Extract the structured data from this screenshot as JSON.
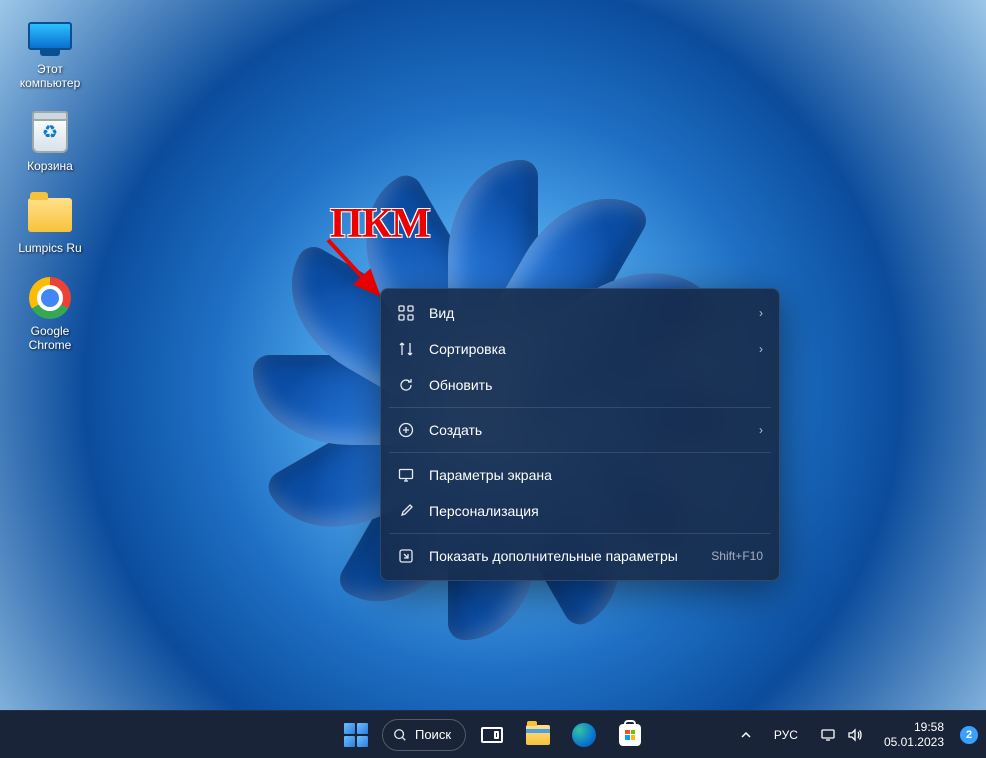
{
  "desktop_icons": [
    {
      "id": "this-pc",
      "label": "Этот\nкомпьютер"
    },
    {
      "id": "recycle",
      "label": "Корзина"
    },
    {
      "id": "folder",
      "label": "Lumpics Ru"
    },
    {
      "id": "chrome",
      "label": "Google\nChrome"
    }
  ],
  "annotation": {
    "label": "ПКМ"
  },
  "context_menu": {
    "items": [
      {
        "icon": "view",
        "label": "Вид",
        "submenu": true
      },
      {
        "icon": "sort",
        "label": "Сортировка",
        "submenu": true
      },
      {
        "icon": "refresh",
        "label": "Обновить",
        "submenu": false
      },
      {
        "sep": true
      },
      {
        "icon": "new",
        "label": "Создать",
        "submenu": true
      },
      {
        "sep": true
      },
      {
        "icon": "display",
        "label": "Параметры экрана",
        "submenu": false
      },
      {
        "icon": "personalize",
        "label": "Персонализация",
        "submenu": false
      },
      {
        "sep": true
      },
      {
        "icon": "more",
        "label": "Показать дополнительные параметры",
        "shortcut": "Shift+F10"
      }
    ]
  },
  "taskbar": {
    "search_label": "Поиск",
    "lang": "РУС",
    "time": "19:58",
    "date": "05.01.2023",
    "notif_count": "2"
  }
}
